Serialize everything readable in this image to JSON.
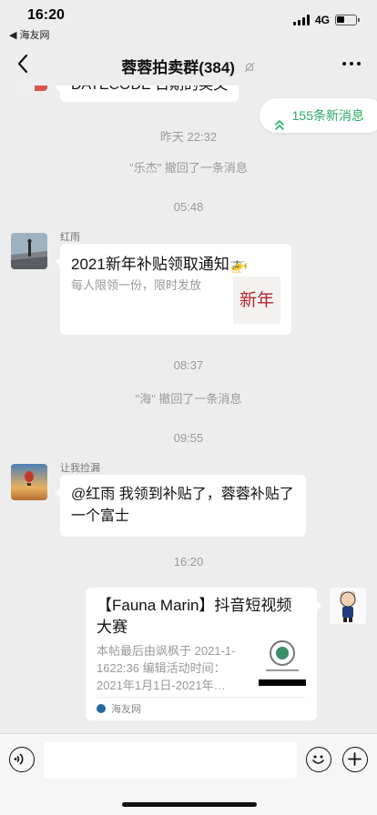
{
  "status_bar": {
    "time": "16:20",
    "back_app": "◀ 海友网",
    "network": "4G"
  },
  "nav": {
    "title": "蓉蓉拍卖群(384)",
    "back_icon": "chevron-left-icon",
    "more_icon": "more-dots-icon",
    "mute_icon": "bell-muted-icon"
  },
  "chat": {
    "partial_top_text": "DATECODE 日期的英文",
    "new_messages_label": "155条新消息",
    "timestamps": [
      "昨天 22:32",
      "05:48",
      "08:37",
      "09:55",
      "16:20"
    ],
    "system_messages": [
      "\"乐杰\" 撤回了一条消息",
      "\"海\" 撤回了一条消息"
    ],
    "messages": [
      {
        "sender": "红雨",
        "card_title": "2021新年补贴领取通知🚁",
        "card_desc": "每人限领一份，限时发放",
        "thumb_text": "新年"
      },
      {
        "sender": "让我捡漏",
        "text": "@红雨 我领到补贴了，蓉蓉补贴了一个富士"
      },
      {
        "link_title": "【Fauna Marin】抖音短视频大赛",
        "link_desc": "本帖最后由飒枫于 2021-1-1622:36 编辑活动时间：2021年1月1日-2021年…",
        "link_source": "海友网"
      }
    ]
  },
  "input_bar": {
    "voice_icon": "voice-icon",
    "emoji_icon": "emoji-icon",
    "plus_icon": "plus-icon"
  },
  "colors": {
    "background": "#ededed",
    "accent_green": "#2aae67",
    "bubble": "#ffffff"
  }
}
